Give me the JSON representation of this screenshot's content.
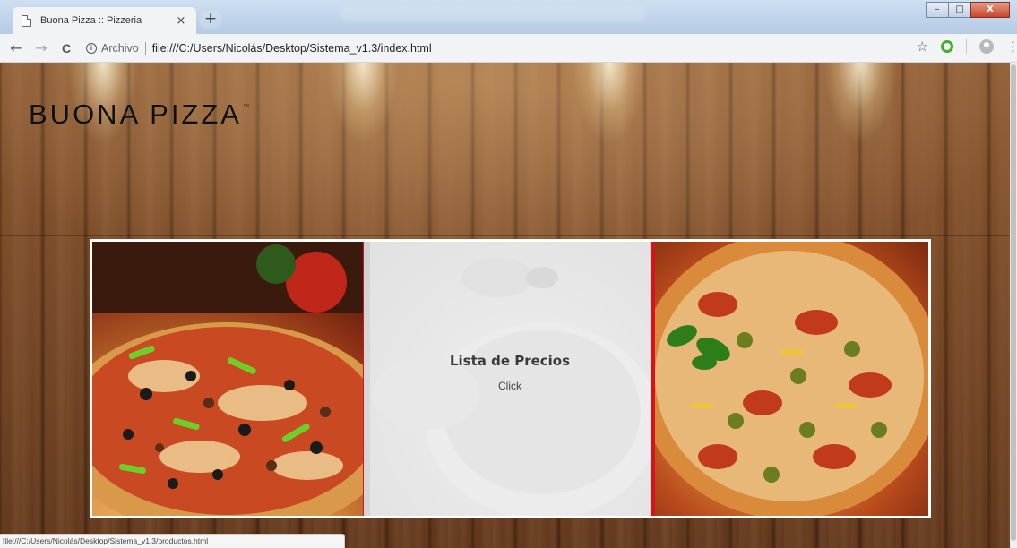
{
  "browser": {
    "tab": {
      "title": "Buona Pizza :: Pizzeria",
      "close": "×"
    },
    "new_tab": "+",
    "window_controls": {
      "minimize": "–",
      "maximize": "□",
      "close": "X"
    },
    "nav": {
      "back": "←",
      "forward": "→",
      "reload": "C"
    },
    "omnibox": {
      "info": "i",
      "scheme_label": "Archivo",
      "url": "file:///C:/Users/Nicolás/Desktop/Sistema_v1.3/index.html"
    },
    "star": "☆",
    "menu": "⋮",
    "status_url": "file:///C:/Users/Nicolás/Desktop/Sistema_v1.3/productos.html"
  },
  "page": {
    "brand": "BUONA PIZZA",
    "brand_mark": "™",
    "gallery": {
      "center_title": "Lista de Precios",
      "center_sub": "Click",
      "highlight_color": "#d3141a"
    }
  }
}
